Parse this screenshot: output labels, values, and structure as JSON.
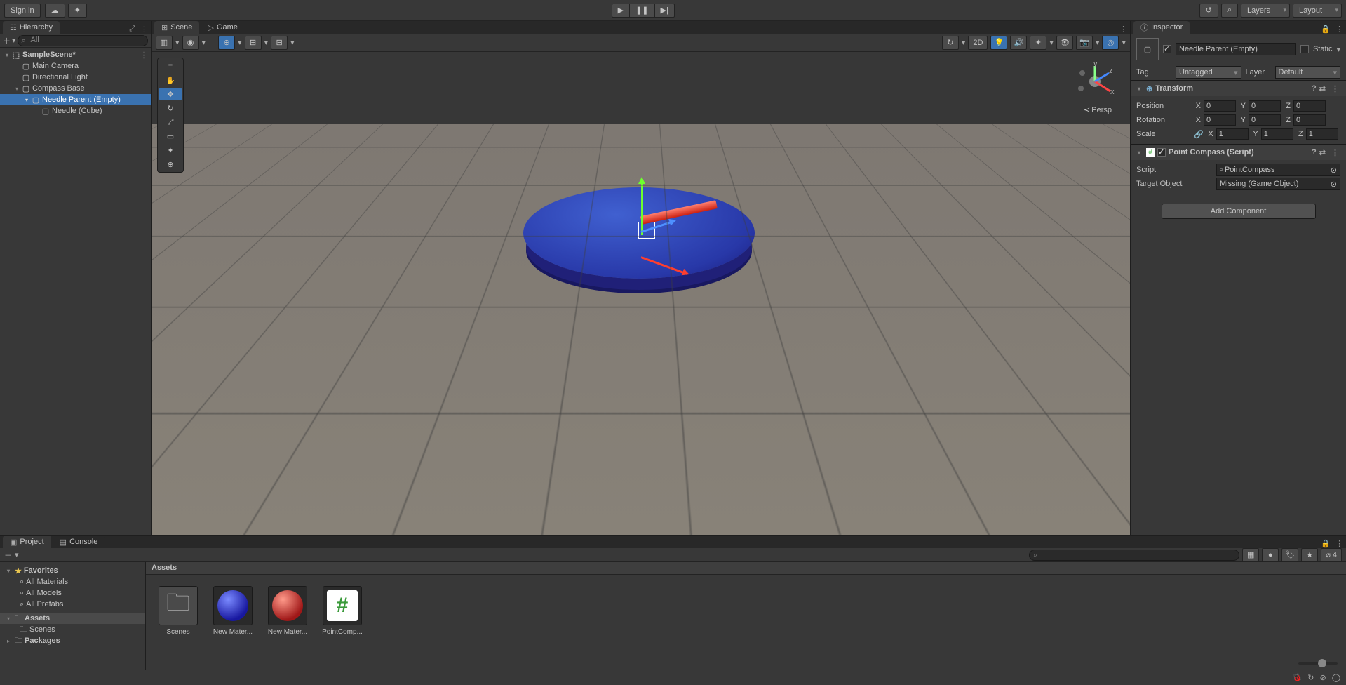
{
  "topbar": {
    "signin": "Sign in",
    "layers": "Layers",
    "layout": "Layout"
  },
  "tabs": {
    "hierarchy": "Hierarchy",
    "scene": "Scene",
    "game": "Game",
    "inspector": "Inspector",
    "project": "Project",
    "console": "Console"
  },
  "hierarchy": {
    "search_placeholder": "All",
    "scene": "SampleScene*",
    "items": [
      {
        "label": "Main Camera",
        "depth": 1
      },
      {
        "label": "Directional Light",
        "depth": 1
      },
      {
        "label": "Compass Base",
        "depth": 1,
        "expandable": true
      },
      {
        "label": "Needle Parent (Empty)",
        "depth": 2,
        "expandable": true,
        "selected": true
      },
      {
        "label": "Needle (Cube)",
        "depth": 3
      }
    ]
  },
  "scene": {
    "tb_2d": "2D",
    "persp": "Persp",
    "axes": {
      "x": "x",
      "y": "y",
      "z": "z"
    }
  },
  "inspector": {
    "name": "Needle Parent (Empty)",
    "static": "Static",
    "tag_label": "Tag",
    "tag_value": "Untagged",
    "layer_label": "Layer",
    "layer_value": "Default",
    "transform": {
      "title": "Transform",
      "position": "Position",
      "rotation": "Rotation",
      "scale": "Scale",
      "pos": {
        "x": "0",
        "y": "0",
        "z": "0"
      },
      "rot": {
        "x": "0",
        "y": "0",
        "z": "0"
      },
      "scl": {
        "x": "1",
        "y": "1",
        "z": "1"
      }
    },
    "compass": {
      "title": "Point Compass (Script)",
      "script_label": "Script",
      "script_value": "PointCompass",
      "target_label": "Target Object",
      "target_value": "Missing (Game Object)"
    },
    "add_component": "Add Component"
  },
  "project": {
    "path": "Assets",
    "hidden_count": "4",
    "favorites": "Favorites",
    "fav_items": [
      "All Materials",
      "All Models",
      "All Prefabs"
    ],
    "folders": {
      "assets": "Assets",
      "scenes": "Scenes",
      "packages": "Packages"
    },
    "grid": [
      {
        "type": "folder",
        "label": "Scenes"
      },
      {
        "type": "mat-blue",
        "label": "New Mater..."
      },
      {
        "type": "mat-red",
        "label": "New Mater..."
      },
      {
        "type": "script",
        "label": "PointComp..."
      }
    ]
  }
}
